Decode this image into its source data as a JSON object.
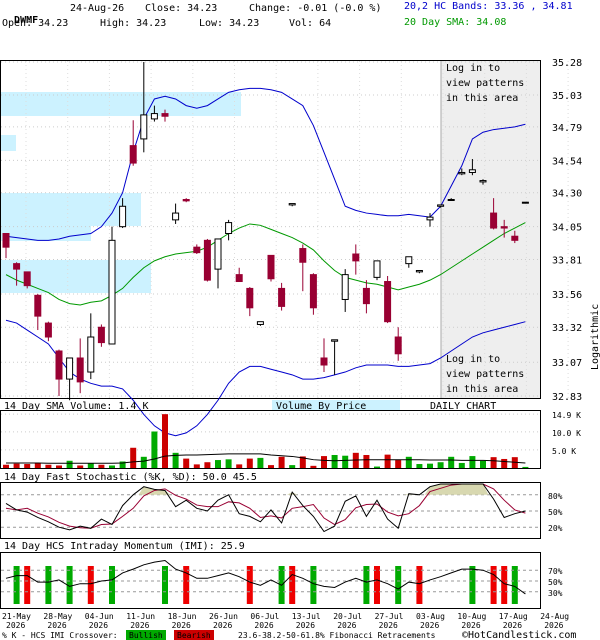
{
  "header": {
    "symbol": "DWMF",
    "date": "24-Aug-26",
    "close_label": "Close:",
    "close": "34.23",
    "change_label": "Change:",
    "change": "-0.01 (-0.0 %)",
    "open_label": "Open:",
    "open": "34.23",
    "high_label": "High:",
    "high": "34.23",
    "low_label": "Low:",
    "low": "34.23",
    "vol_label": "Vol:",
    "vol": "64",
    "bands_label": "20,2 HC Bands:",
    "bands": "33.36 , 34.81",
    "sma_label": "20 Day SMA:",
    "sma": "34.08"
  },
  "colors": {
    "up": "#00aa00",
    "down": "#990033",
    "band": "#0000cc",
    "sma": "#009900",
    "vbp": "#ccf2ff",
    "shade": "#eeeeee",
    "stoch_k": "#000000",
    "stoch_d": "#990033",
    "fill": "#d8d8b0"
  },
  "chart_data": [
    {
      "type": "candlestick",
      "scale": "logarithmic",
      "ylim": [
        32.83,
        35.28
      ],
      "y_ticks": [
        "35.28",
        "35.03",
        "34.79",
        "34.54",
        "34.30",
        "34.05",
        "33.81",
        "33.56",
        "33.32",
        "33.07",
        "32.83"
      ],
      "ylabel": "Logarithmic",
      "overlay_text": [
        "Log in to",
        "view patterns",
        "in this area"
      ],
      "series": {
        "open": [
          34.0,
          33.78,
          33.72,
          33.55,
          33.35,
          33.15,
          32.95,
          33.1,
          33.0,
          33.32,
          33.2,
          34.05,
          34.65,
          34.7,
          34.85,
          34.89,
          34.1,
          34.25,
          33.9,
          33.95,
          33.74,
          34.0,
          33.7,
          33.6,
          33.34,
          33.84,
          33.6,
          34.21,
          33.89,
          33.7,
          33.1,
          33.22,
          33.52,
          33.85,
          33.6,
          33.68,
          33.65,
          33.25,
          33.78,
          33.72,
          34.1,
          34.2,
          34.25,
          34.44,
          34.45,
          34.38,
          34.15,
          34.05,
          33.98,
          34.23
        ],
        "high": [
          34.0,
          33.79,
          33.72,
          33.56,
          33.36,
          33.16,
          32.98,
          33.24,
          33.42,
          33.34,
          34.05,
          34.26,
          34.84,
          35.28,
          34.95,
          34.92,
          34.22,
          34.26,
          33.92,
          33.96,
          33.76,
          34.1,
          33.75,
          33.61,
          33.34,
          33.84,
          33.64,
          34.22,
          33.92,
          33.71,
          33.24,
          33.23,
          33.74,
          33.92,
          33.66,
          33.8,
          33.69,
          33.32,
          33.82,
          33.73,
          34.15,
          34.21,
          34.26,
          34.48,
          34.55,
          34.4,
          34.26,
          34.1,
          34.02,
          34.23
        ],
        "low": [
          33.82,
          33.62,
          33.6,
          33.3,
          33.22,
          32.83,
          32.8,
          32.85,
          32.95,
          33.18,
          33.2,
          34.04,
          34.5,
          34.6,
          34.83,
          34.83,
          34.07,
          34.23,
          33.85,
          33.65,
          33.6,
          33.95,
          33.66,
          33.4,
          33.33,
          33.65,
          33.44,
          34.2,
          33.58,
          33.41,
          33.0,
          32.98,
          33.43,
          33.7,
          33.42,
          33.66,
          33.35,
          33.08,
          33.75,
          33.71,
          34.05,
          34.19,
          34.24,
          34.43,
          34.43,
          34.36,
          34.03,
          33.97,
          33.93,
          34.22
        ],
        "close": [
          33.9,
          33.74,
          33.62,
          33.4,
          33.25,
          32.95,
          33.1,
          32.93,
          33.25,
          33.21,
          33.95,
          34.2,
          34.52,
          34.88,
          34.89,
          34.87,
          34.15,
          34.24,
          33.86,
          33.66,
          33.96,
          34.08,
          33.65,
          33.46,
          33.36,
          33.67,
          33.47,
          34.22,
          33.79,
          33.46,
          33.05,
          33.23,
          33.7,
          33.8,
          33.49,
          33.8,
          33.36,
          33.13,
          33.83,
          33.73,
          34.12,
          34.21,
          34.25,
          34.45,
          34.47,
          34.39,
          34.04,
          34.04,
          33.95,
          34.23
        ],
        "upper_band": [
          33.98,
          33.97,
          33.96,
          33.95,
          33.95,
          33.96,
          33.98,
          33.99,
          34.0,
          34.05,
          34.15,
          34.3,
          34.6,
          34.85,
          35.0,
          35.02,
          35.0,
          34.95,
          34.93,
          34.95,
          35.0,
          35.05,
          35.07,
          35.08,
          35.08,
          35.07,
          35.05,
          35.0,
          34.95,
          34.8,
          34.6,
          34.4,
          34.2,
          34.17,
          34.15,
          34.14,
          34.13,
          34.13,
          34.14,
          34.13,
          34.12,
          34.2,
          34.35,
          34.5,
          34.7,
          34.75,
          34.77,
          34.78,
          34.79,
          34.81
        ],
        "sma": [
          33.7,
          33.66,
          33.63,
          33.6,
          33.57,
          33.52,
          33.49,
          33.48,
          33.5,
          33.51,
          33.55,
          33.6,
          33.68,
          33.75,
          33.8,
          33.83,
          33.85,
          33.86,
          33.87,
          33.9,
          33.95,
          34.0,
          34.04,
          34.07,
          34.06,
          34.03,
          34.0,
          33.97,
          33.93,
          33.88,
          33.8,
          33.73,
          33.68,
          33.66,
          33.64,
          33.63,
          33.61,
          33.59,
          33.61,
          33.63,
          33.66,
          33.7,
          33.75,
          33.8,
          33.85,
          33.9,
          33.95,
          34.0,
          34.04,
          34.08
        ],
        "lower_band": [
          33.37,
          33.35,
          33.3,
          33.25,
          33.2,
          33.1,
          33.0,
          32.95,
          32.92,
          32.9,
          32.9,
          32.88,
          32.8,
          32.7,
          32.62,
          32.57,
          32.55,
          32.57,
          32.62,
          32.7,
          32.8,
          32.92,
          33.0,
          33.04,
          33.04,
          33.02,
          33.0,
          32.98,
          32.95,
          32.95,
          32.96,
          32.98,
          33.0,
          33.03,
          33.05,
          33.05,
          33.05,
          33.04,
          33.04,
          33.05,
          33.06,
          33.1,
          33.15,
          33.2,
          33.25,
          33.28,
          33.3,
          33.32,
          33.34,
          33.36
        ]
      }
    },
    {
      "type": "bar",
      "title": "14 Day SMA Volume: 1.4 K",
      "label": "Volume By Price",
      "caption": "DAILY CHART",
      "y_ticks": [
        "14.9 K",
        "10.0 K",
        "5.0 K"
      ],
      "values": [
        0.9,
        1.2,
        1.1,
        1.3,
        0.9,
        0.7,
        2.0,
        0.7,
        1.3,
        0.9,
        0.7,
        1.8,
        5.6,
        3.1,
        10.1,
        14.9,
        4.2,
        2.6,
        1.0,
        1.6,
        2.2,
        2.4,
        1.0,
        2.6,
        2.8,
        0.8,
        3.1,
        0.8,
        3.2,
        0.6,
        3.3,
        3.6,
        3.4,
        4.2,
        3.6,
        0.4,
        3.7,
        2.2,
        3.1,
        1.1,
        1.2,
        1.6,
        3.1,
        1.4,
        3.3,
        2.0,
        3.0,
        2.5,
        3.0,
        0.3
      ],
      "sma": [
        1.4,
        1.4,
        1.4,
        1.4,
        1.3,
        1.3,
        1.3,
        1.3,
        1.3,
        1.3,
        1.3,
        1.4,
        1.7,
        1.9,
        2.5,
        3.3,
        3.5,
        3.6,
        3.6,
        3.7,
        3.8,
        3.9,
        3.9,
        3.9,
        3.9,
        3.6,
        3.4,
        3.2,
        2.8,
        2.3,
        2.1,
        2.0,
        2.1,
        2.2,
        2.3,
        2.3,
        2.3,
        2.3,
        2.3,
        2.3,
        2.2,
        2.2,
        2.2,
        2.1,
        2.1,
        2.1,
        2.0,
        1.8,
        1.6,
        1.4
      ]
    },
    {
      "type": "line",
      "title": "14 Day Fast Stochastic (%K, %D): 50.0   45.5",
      "y_ticks": [
        "80%",
        "50%",
        "20%"
      ],
      "k": [
        64,
        52,
        48,
        38,
        30,
        20,
        15,
        22,
        18,
        35,
        25,
        60,
        80,
        95,
        90,
        88,
        58,
        70,
        55,
        50,
        70,
        80,
        45,
        40,
        30,
        52,
        28,
        85,
        60,
        40,
        12,
        22,
        68,
        78,
        40,
        70,
        35,
        18,
        82,
        80,
        95,
        100,
        100,
        100,
        100,
        100,
        72,
        38,
        45,
        50
      ],
      "d": [
        55,
        52,
        55,
        46,
        39,
        29,
        22,
        19,
        18,
        25,
        26,
        40,
        55,
        78,
        88,
        91,
        79,
        72,
        61,
        58,
        58,
        67,
        65,
        55,
        38,
        41,
        37,
        55,
        58,
        62,
        37,
        25,
        34,
        56,
        62,
        63,
        48,
        41,
        45,
        60,
        86,
        92,
        98,
        100,
        100,
        100,
        91,
        70,
        52,
        46
      ]
    },
    {
      "type": "bar",
      "title": "14 Day HCS Intraday Momentum (IMI): 25.9",
      "y_ticks": [
        "70%",
        "50%",
        "30%"
      ],
      "imi": [
        55,
        60,
        60,
        48,
        48,
        52,
        40,
        45,
        45,
        50,
        52,
        65,
        72,
        80,
        85,
        88,
        72,
        65,
        55,
        55,
        60,
        65,
        58,
        48,
        42,
        52,
        42,
        62,
        55,
        45,
        40,
        38,
        48,
        55,
        48,
        52,
        45,
        35,
        48,
        45,
        52,
        58,
        65,
        72,
        72,
        70,
        62,
        45,
        40,
        26
      ],
      "signals": [
        [
          "b",
          1
        ],
        [
          "r",
          2
        ],
        [
          "b",
          4
        ],
        [
          "b",
          6
        ],
        [
          "r",
          8
        ],
        [
          "b",
          10
        ],
        [
          "b",
          15
        ],
        [
          "r",
          17
        ],
        [
          "r",
          23
        ],
        [
          "b",
          26
        ],
        [
          "r",
          27
        ],
        [
          "b",
          29
        ],
        [
          "b",
          34
        ],
        [
          "r",
          35
        ],
        [
          "b",
          37
        ],
        [
          "r",
          39
        ],
        [
          "b",
          44
        ],
        [
          "r",
          46
        ],
        [
          "r",
          47
        ],
        [
          "b",
          48
        ]
      ]
    }
  ],
  "x_ticks": [
    [
      "21-May",
      "2026"
    ],
    [
      "28-May",
      "2026"
    ],
    [
      "04-Jun",
      "2026"
    ],
    [
      "11-Jun",
      "2026"
    ],
    [
      "18-Jun",
      "2026"
    ],
    [
      "26-Jun",
      "2026"
    ],
    [
      "06-Jul",
      "2026"
    ],
    [
      "13-Jul",
      "2026"
    ],
    [
      "20-Jul",
      "2026"
    ],
    [
      "27-Jul",
      "2026"
    ],
    [
      "03-Aug",
      "2026"
    ],
    [
      "10-Aug",
      "2026"
    ],
    [
      "17-Aug",
      "2026"
    ],
    [
      "24-Aug",
      "2026"
    ]
  ],
  "footer": {
    "legend": "% K - HCS IMI Crossover:",
    "bullish": "Bullish",
    "bearish": "Bearish",
    "fib": "23.6-38.2-50-61.8% Fibonacci Retracements",
    "credit": "©HotCandlestick.com"
  }
}
